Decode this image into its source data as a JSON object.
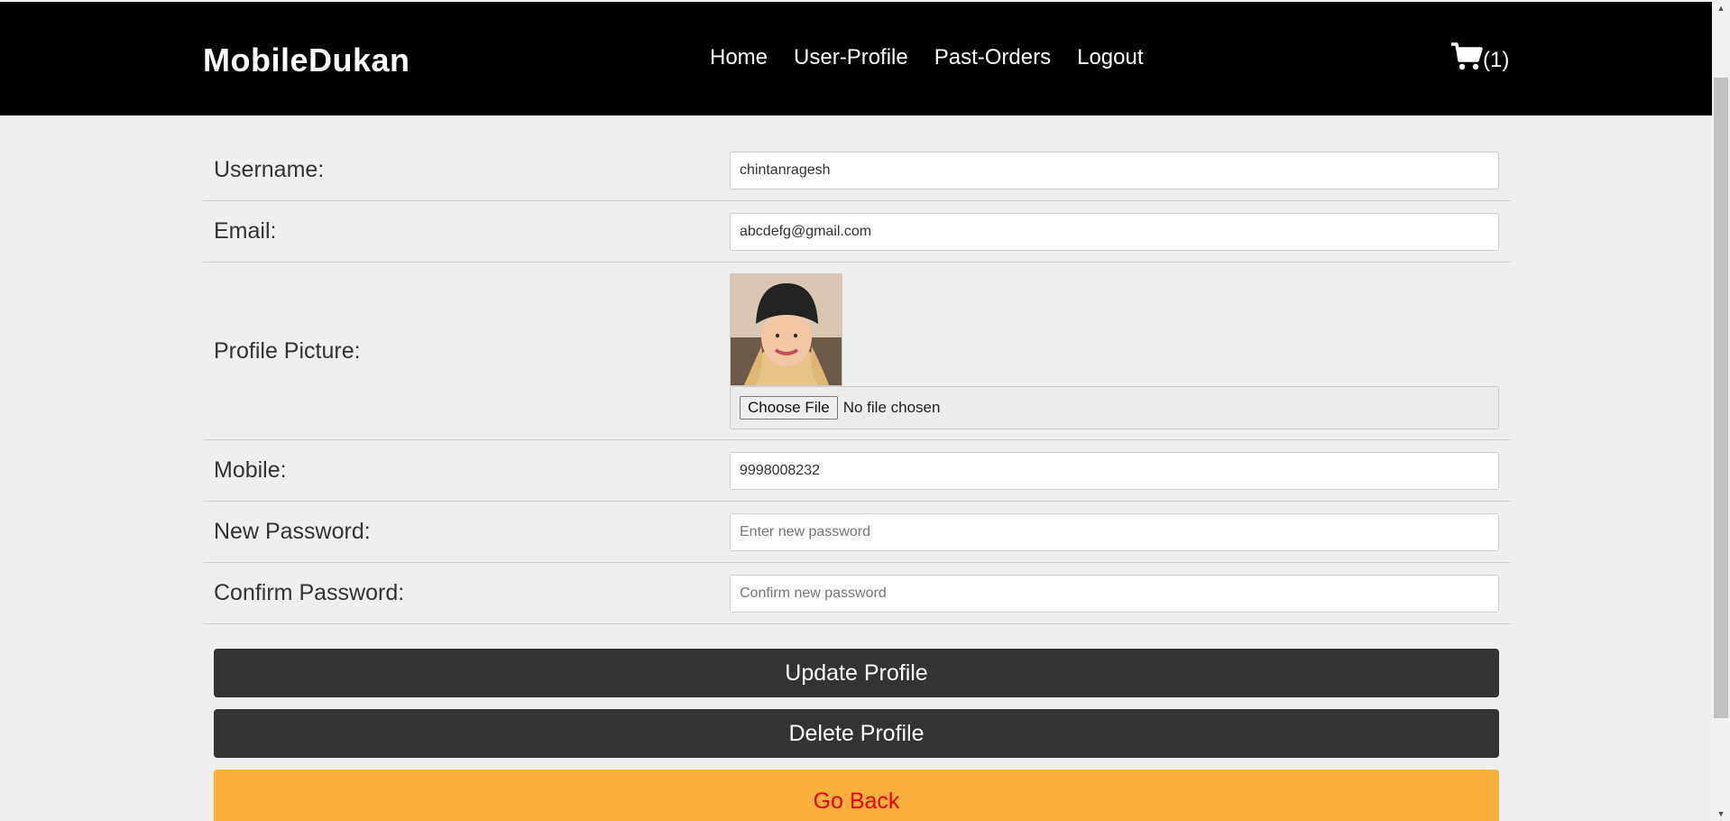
{
  "header": {
    "brand": "MobileDukan",
    "nav": [
      "Home",
      "User-Profile",
      "Past-Orders",
      "Logout"
    ],
    "cart_count": "(1)"
  },
  "form": {
    "username": {
      "label": "Username:",
      "value": "chintanragesh"
    },
    "email": {
      "label": "Email:",
      "value": "abcdefg@gmail.com"
    },
    "profile_picture": {
      "label": "Profile Picture:",
      "choose_file": "Choose File",
      "file_status": "No file chosen"
    },
    "mobile": {
      "label": "Mobile:",
      "value": "9998008232"
    },
    "new_password": {
      "label": "New Password:",
      "placeholder": "Enter new password"
    },
    "confirm_password": {
      "label": "Confirm Password:",
      "placeholder": "Confirm new password"
    }
  },
  "buttons": {
    "update": "Update Profile",
    "delete": "Delete Profile",
    "back": "Go Back"
  },
  "colors": {
    "header_bg": "#000000",
    "page_bg": "#efefef",
    "dark_button": "#333333",
    "go_back_bg": "#fbb03b",
    "go_back_text": "#e60000"
  }
}
